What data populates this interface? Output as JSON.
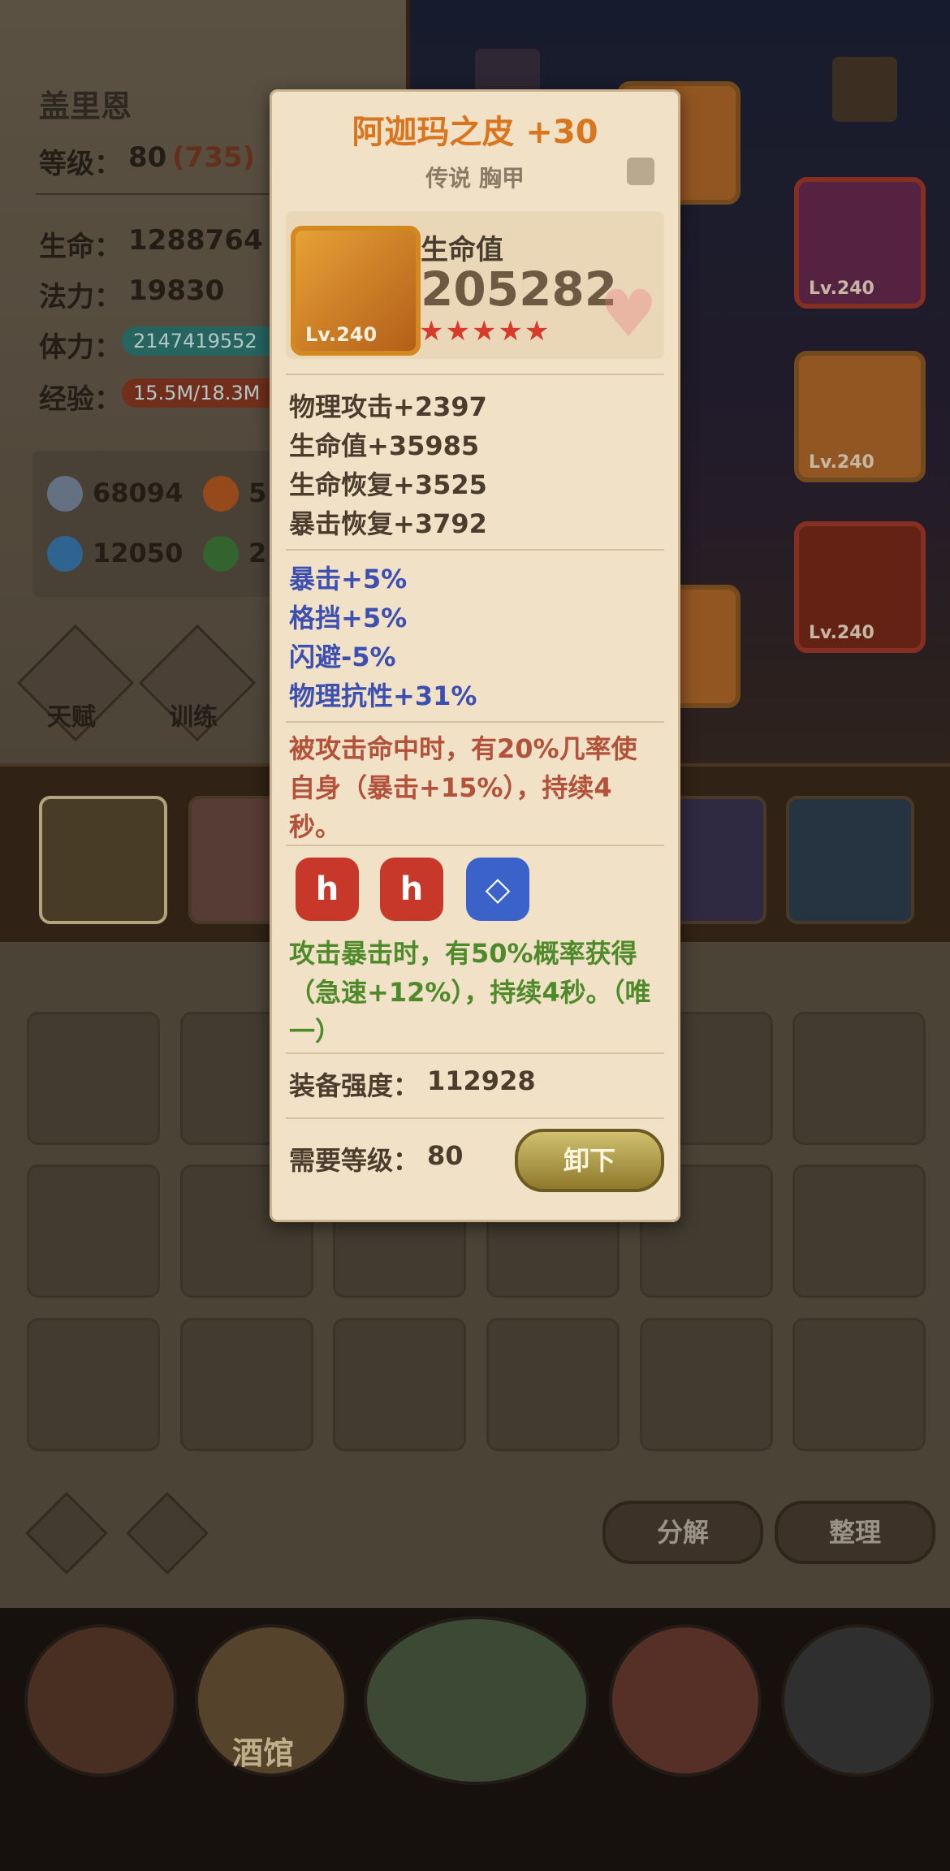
{
  "hero": {
    "name": "盖里恩",
    "level_label": "等级：",
    "level": "80",
    "level_extra": "(735)",
    "hp_label": "生命：",
    "hp": "1288764",
    "mp_label": "法力：",
    "mp": "19830",
    "stamina_label": "体力：",
    "stamina": "2147419552",
    "exp_label": "经验：",
    "exp": "15.5M/18.3M",
    "res": [
      "68094",
      "5",
      "12050",
      "2"
    ],
    "buttons": [
      "天赋",
      "训练"
    ]
  },
  "equip_slots": [
    {
      "level": "Lv.240"
    },
    {
      "level": "Lv.240"
    },
    {
      "level": "Lv.240"
    }
  ],
  "tooltip": {
    "title": "阿迦玛之皮 +30",
    "subtitle": "传说 胸甲",
    "item_level": "Lv.240",
    "main_stat_name": "生命值",
    "main_stat_value": "205282",
    "stars": "★★★★★",
    "base_stats": [
      "物理攻击+2397",
      "生命值+35985",
      "生命恢复+3525",
      "暴击恢复+3792"
    ],
    "bonus_stats": [
      "暴击+5%",
      "格挡+5%",
      "闪避-5%",
      "物理抗性+31%"
    ],
    "passive": "被攻击命中时，有20%几率使自身（暴击+15%），持续4秒。",
    "set_effect": "攻击暴击时，有50%概率获得（急速+12%），持续4秒。（唯一）",
    "power_label": "装备强度：",
    "power": "112928",
    "req_label": "需要等级：",
    "req_level": "80",
    "unequip": "卸下"
  },
  "bag": {
    "decompose": "分解",
    "sort": "整理"
  },
  "nav": {
    "tavern": "酒馆"
  }
}
